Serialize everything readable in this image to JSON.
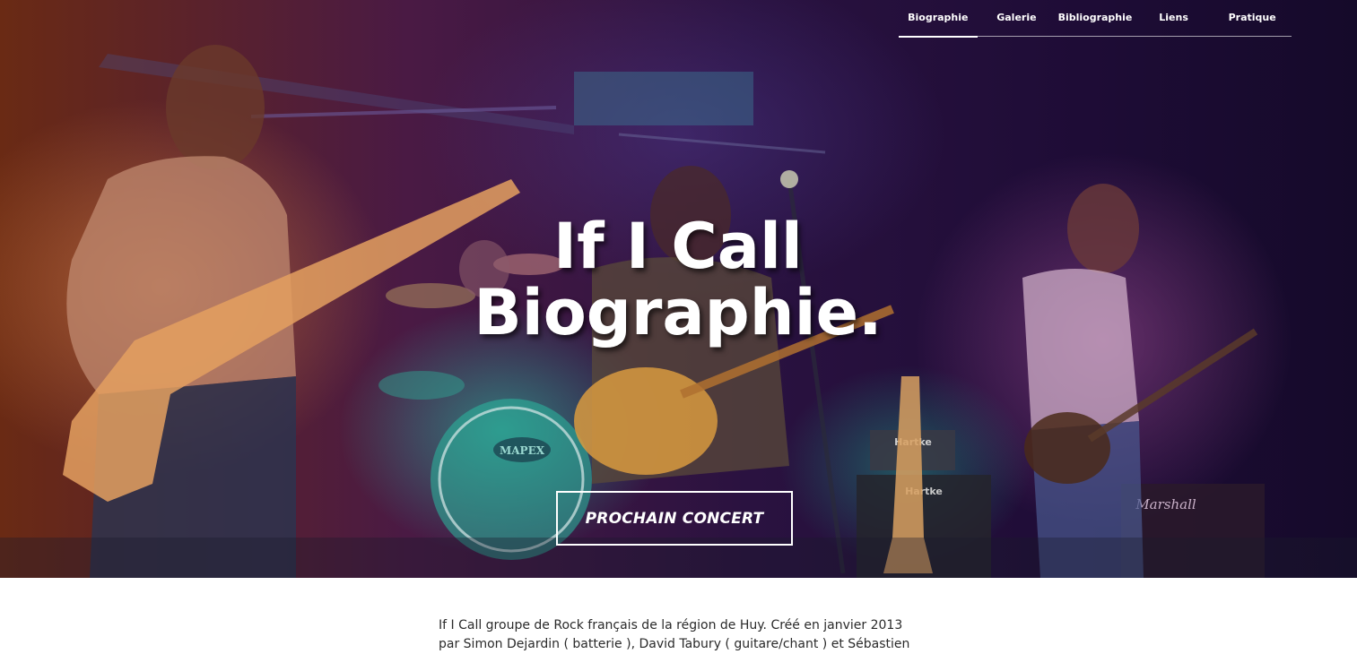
{
  "nav": {
    "items": [
      {
        "label": "Biographie",
        "active": true
      },
      {
        "label": "Galerie",
        "active": false
      },
      {
        "label": "Bibliographie",
        "active": false
      },
      {
        "label": "Liens",
        "active": false
      },
      {
        "label": "Pratique",
        "active": false
      }
    ]
  },
  "hero": {
    "title_line1": "If I Call",
    "title_line2": "Biographie.",
    "cta_label": "PROCHAIN CONCERT",
    "image_description_icon": "band-photo",
    "image_text": {
      "drum_logo": "MAPEX",
      "amp1": "Hartke",
      "amp2": "Hartke",
      "amp_brand": "Marshall"
    }
  },
  "content": {
    "paragraph_line1": "If I Call groupe de Rock français de la région de Huy. Créé en janvier 2013",
    "paragraph_line2": "par Simon Dejardin ( batterie ), David Tabury ( guitare/chant ) et Sébastien"
  },
  "colors": {
    "text_light": "#ffffff",
    "body_text": "#2a2a2a"
  }
}
